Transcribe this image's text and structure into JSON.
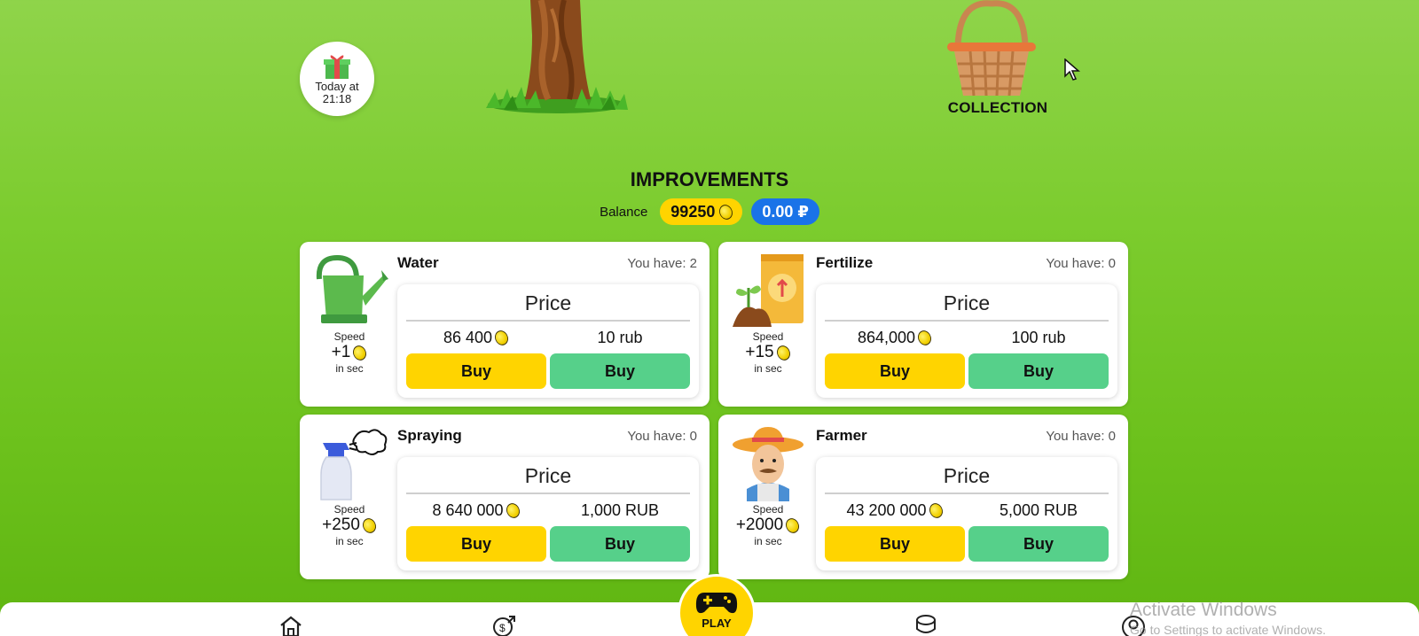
{
  "gift": {
    "time_line1": "Today at",
    "time_line2": "21:18"
  },
  "collection": {
    "label": "COLLECTION"
  },
  "improvements": {
    "title": "IMPROVEMENTS",
    "balance_label": "Balance",
    "balance_coins": "99250",
    "balance_rub": "0.00 ₽"
  },
  "cards": [
    {
      "name": "Water",
      "have": "You have: 2",
      "speed_label": "Speed",
      "speed_value": "+1",
      "speed_unit": "in sec",
      "price_title": "Price",
      "price_coins": "86 400",
      "price_rub": "10 rub",
      "buy_coins_label": "Buy",
      "buy_rub_label": "Buy"
    },
    {
      "name": "Fertilize",
      "have": "You have: 0",
      "speed_label": "Speed",
      "speed_value": "+15",
      "speed_unit": "in sec",
      "price_title": "Price",
      "price_coins": "864,000",
      "price_rub": "100 rub",
      "buy_coins_label": "Buy",
      "buy_rub_label": "Buy"
    },
    {
      "name": "Spraying",
      "have": "You have: 0",
      "speed_label": "Speed",
      "speed_value": "+250",
      "speed_unit": "in sec",
      "price_title": "Price",
      "price_coins": "8 640 000",
      "price_rub": "1,000 RUB",
      "buy_coins_label": "Buy",
      "buy_rub_label": "Buy"
    },
    {
      "name": "Farmer",
      "have": "You have: 0",
      "speed_label": "Speed",
      "speed_value": "+2000",
      "speed_unit": "in sec",
      "price_title": "Price",
      "price_coins": "43 200 000",
      "price_rub": "5,000 RUB",
      "buy_coins_label": "Buy",
      "buy_rub_label": "Buy"
    }
  ],
  "nav": {
    "play_label": "PLAY",
    "items": [
      "home-icon",
      "exchange-icon",
      "play-icon",
      "coin-stack-icon",
      "profile-icon"
    ]
  },
  "watermark": {
    "line1": "Activate Windows",
    "line2": "Go to Settings to activate Windows."
  },
  "colors": {
    "yellow": "#ffd400",
    "green": "#56d08a",
    "blue": "#1a73e8"
  }
}
